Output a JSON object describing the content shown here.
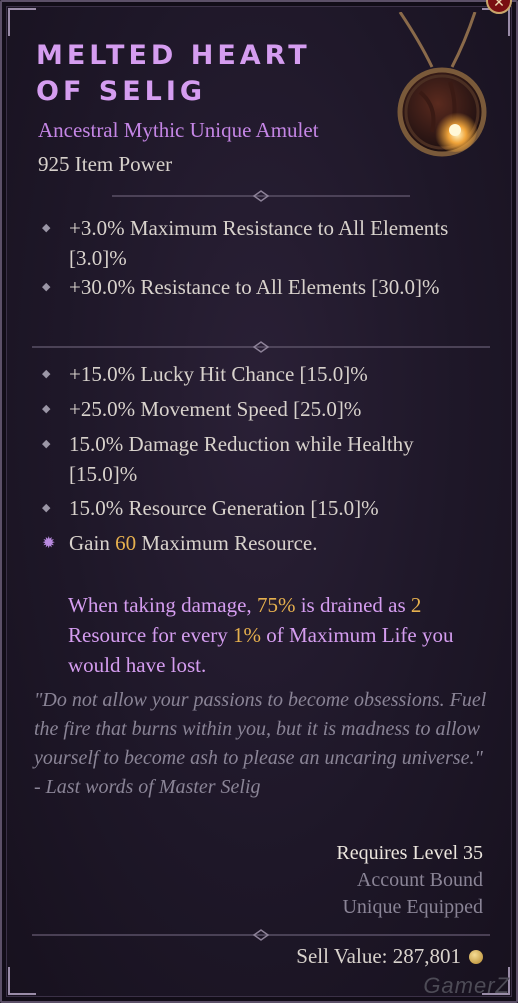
{
  "item": {
    "name": "Melted Heart of Selig",
    "type": "Ancestral Mythic Unique Amulet",
    "item_power": "925 Item Power"
  },
  "implicit_affixes": [
    "+3.0% Maximum Resistance to All Elements [3.0]%",
    "+30.0% Resistance to All Elements [30.0]%"
  ],
  "affixes": [
    "+15.0% Lucky Hit Chance [15.0]%",
    "+25.0% Movement Speed [25.0]%",
    "15.0% Damage Reduction while Healthy [15.0]%",
    "15.0% Resource Generation [15.0]%"
  ],
  "special_affix": {
    "before": "Gain ",
    "value": "60",
    "after": " Maximum Resource."
  },
  "unique_power": {
    "p1": "When taking damage, ",
    "v1": "75%",
    "p2": " is drained as ",
    "v2": "2",
    "p3": " Resource for every ",
    "v3": "1%",
    "p4": " of Maximum Life you would have lost."
  },
  "flavor": {
    "quote": "\"Do not allow your passions to become obsessions. Fuel the fire that burns within you, but it is madness to allow yourself to become ash to please an uncaring universe.\"",
    "attribution": "- Last words of Master Selig"
  },
  "requirements": {
    "level": "Requires Level 35",
    "bound": "Account Bound",
    "equipped": "Unique Equipped"
  },
  "sell_value": "Sell Value: 287,801",
  "watermark": "GamerZ",
  "icons": {
    "bullet": "diamond-bullet-icon",
    "special": "star-bullet-icon",
    "coin": "gold-coin-icon",
    "close": "close-icon"
  },
  "colors": {
    "unique_purple": "#d59df0",
    "highlight": "#e6b04e",
    "body": "#d8d2cc",
    "flavor": "#8a8496"
  }
}
